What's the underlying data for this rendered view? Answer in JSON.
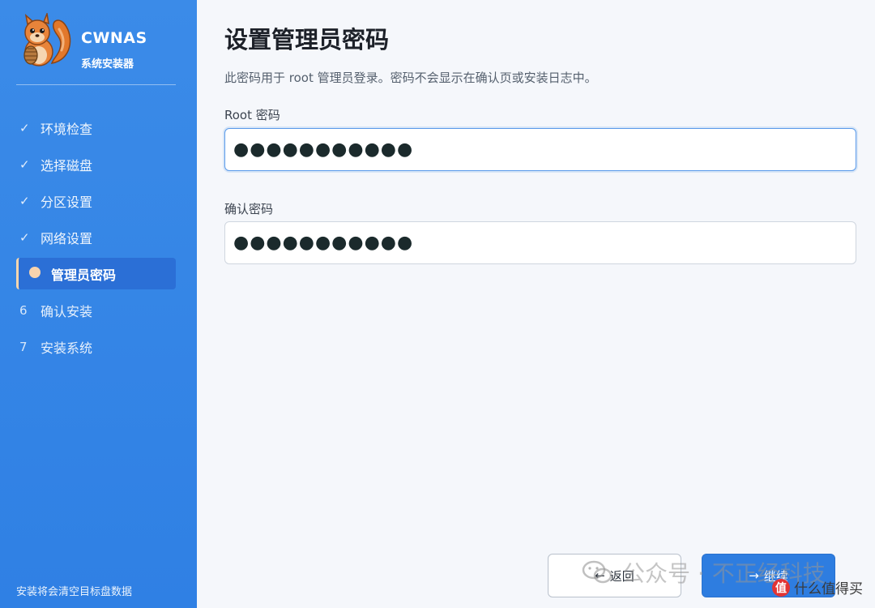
{
  "sidebar": {
    "brand": {
      "name": "CWNAS",
      "subtitle": "系统安装器",
      "logo": "squirrel-logo"
    },
    "steps": [
      {
        "mark": "✓",
        "label": "环境检查",
        "state": "done"
      },
      {
        "mark": "✓",
        "label": "选择磁盘",
        "state": "done"
      },
      {
        "mark": "✓",
        "label": "分区设置",
        "state": "done"
      },
      {
        "mark": "✓",
        "label": "网络设置",
        "state": "done"
      },
      {
        "mark": "dot",
        "label": "管理员密码",
        "state": "active"
      },
      {
        "mark": "6",
        "label": "确认安装",
        "state": "pending"
      },
      {
        "mark": "7",
        "label": "安装系统",
        "state": "pending"
      }
    ],
    "footnote": "安装将会清空目标盘数据"
  },
  "main": {
    "title": "设置管理员密码",
    "description": "此密码用于 root 管理员登录。密码不会显示在确认页或安装日志中。",
    "root_label": "Root 密码",
    "root_value": "●●●●●●●●●●●",
    "confirm_label": "确认密码",
    "confirm_value": "●●●●●●●●●●●",
    "back_label": "返回",
    "next_label": "继续"
  },
  "watermark": {
    "text": "公众号 · 不正经科技",
    "badge_char": "值",
    "site": "什么值得买"
  },
  "colors": {
    "sidebar": "#3b8be8",
    "active_step": "#2b6fd6",
    "active_dot": "#f7d3ae",
    "primary": "#2e7de0"
  }
}
